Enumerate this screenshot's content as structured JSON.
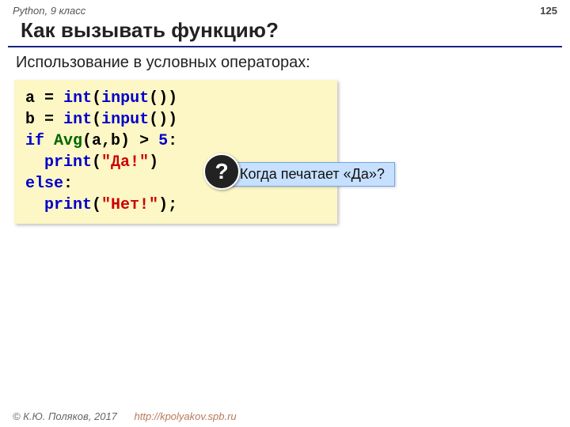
{
  "header": {
    "course": "Python, 9 класс",
    "page": "125"
  },
  "title": "Как вызывать функцию?",
  "subtitle": "Использование в условных операторах:",
  "code": {
    "l1_a": "a",
    "l1_eq": "=",
    "l1_int": "int",
    "l1_input": "input",
    "l2_b": "b",
    "l2_eq": "=",
    "l2_int": "int",
    "l2_input": "input",
    "l3_if": "if",
    "l3_avg": "Avg",
    "l3_args": "(a,b)",
    "l3_gt": ">",
    "l3_five": "5",
    "l3_colon": ":",
    "l4_print": "print",
    "l4_str": "\"Да!\"",
    "l5_else": "else",
    "l5_colon": ":",
    "l6_print": "print",
    "l6_str": "\"Нет!\"",
    "l6_semi": ";"
  },
  "callout": {
    "mark": "?",
    "text": "Когда печатает «Да»?"
  },
  "footer": {
    "copy": "© К.Ю. Поляков, 2017",
    "url": "http://kpolyakov.spb.ru"
  }
}
